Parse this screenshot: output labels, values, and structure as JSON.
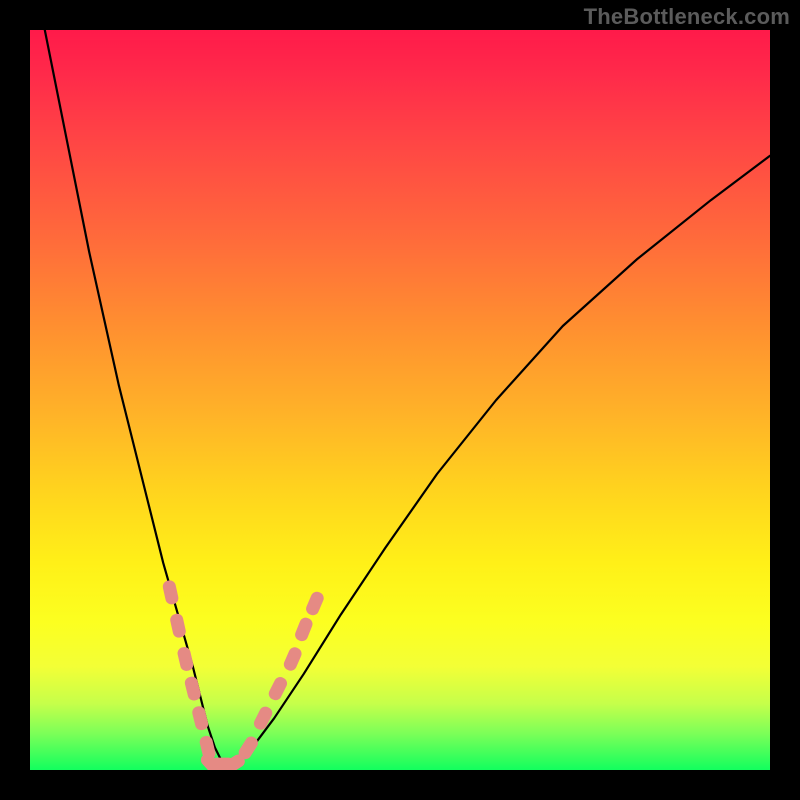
{
  "watermark": {
    "text": "TheBottleneck.com"
  },
  "chart_data": {
    "type": "line",
    "title": "",
    "xlabel": "",
    "ylabel": "",
    "xlim": [
      0,
      100
    ],
    "ylim": [
      0,
      100
    ],
    "grid": false,
    "legend": false,
    "gradient_stops": [
      {
        "pos": 0.0,
        "color": "#ff1a4a"
      },
      {
        "pos": 0.15,
        "color": "#ff4545"
      },
      {
        "pos": 0.4,
        "color": "#ff8f30"
      },
      {
        "pos": 0.62,
        "color": "#ffd31e"
      },
      {
        "pos": 0.8,
        "color": "#fcff20"
      },
      {
        "pos": 0.91,
        "color": "#c6ff4a"
      },
      {
        "pos": 1.0,
        "color": "#12ff5e"
      }
    ],
    "series": [
      {
        "name": "bottleneck-curve",
        "x": [
          2,
          4,
          6,
          8,
          10,
          12,
          14,
          16,
          18,
          20,
          22,
          23,
          24,
          25,
          26,
          27,
          28,
          30,
          33,
          37,
          42,
          48,
          55,
          63,
          72,
          82,
          92,
          100
        ],
        "y": [
          100,
          90,
          80,
          70,
          61,
          52,
          44,
          36,
          28,
          21,
          14,
          10,
          6,
          3,
          1,
          0,
          1,
          3,
          7,
          13,
          21,
          30,
          40,
          50,
          60,
          69,
          77,
          83
        ]
      }
    ],
    "markers": {
      "name": "lozenge-markers",
      "color": "#e58a84",
      "points": [
        {
          "x": 19.0,
          "y": 24.0
        },
        {
          "x": 20.0,
          "y": 19.5
        },
        {
          "x": 21.0,
          "y": 15.0
        },
        {
          "x": 22.0,
          "y": 11.0
        },
        {
          "x": 23.0,
          "y": 7.0
        },
        {
          "x": 24.0,
          "y": 3.0
        },
        {
          "x": 24.5,
          "y": 0.8
        },
        {
          "x": 26.0,
          "y": 0.8
        },
        {
          "x": 27.5,
          "y": 0.8
        },
        {
          "x": 29.5,
          "y": 3.0
        },
        {
          "x": 31.5,
          "y": 7.0
        },
        {
          "x": 33.5,
          "y": 11.0
        },
        {
          "x": 35.5,
          "y": 15.0
        },
        {
          "x": 37.0,
          "y": 19.0
        },
        {
          "x": 38.5,
          "y": 22.5
        }
      ]
    }
  }
}
